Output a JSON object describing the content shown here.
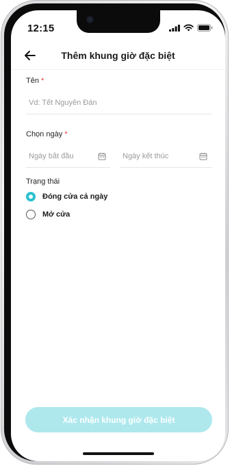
{
  "status_bar": {
    "time": "12:15"
  },
  "header": {
    "title": "Thêm khung giờ đặc biệt",
    "back_icon": "arrow-left-icon"
  },
  "name_field": {
    "label": "Tên",
    "required_mark": "*",
    "placeholder": "Vd: Tết Nguyên Đán",
    "value": ""
  },
  "date_field": {
    "label": "Chọn ngày",
    "required_mark": "*",
    "start_placeholder": "Ngày bắt đầu",
    "end_placeholder": "Ngày kết thúc",
    "icon": "calendar-icon"
  },
  "status_section": {
    "label": "Trạng thái",
    "options": [
      {
        "label": "Đóng cửa cả ngày",
        "selected": true
      },
      {
        "label": "Mở cửa",
        "selected": false
      }
    ]
  },
  "footer": {
    "confirm_label": "Xác nhận khung giờ đặc biệt"
  },
  "colors": {
    "accent": "#2bc1cf",
    "button_disabled": "#aee8ed",
    "required": "#e53935"
  }
}
